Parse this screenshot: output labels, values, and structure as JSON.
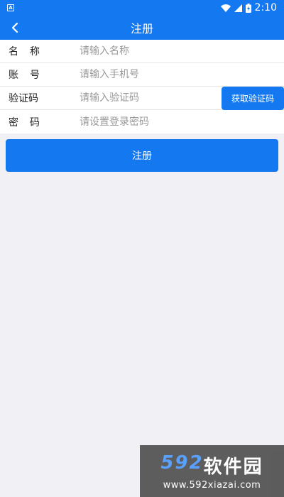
{
  "statusbar": {
    "time": "2:10",
    "notification_icon": "A"
  },
  "header": {
    "title": "注册"
  },
  "form": {
    "name": {
      "label": "名称",
      "placeholder": "请输入名称"
    },
    "account": {
      "label": "账号",
      "placeholder": "请输入手机号"
    },
    "code": {
      "label": "验证码",
      "placeholder": "请输入验证码",
      "button_label": "获取验证码"
    },
    "password": {
      "label": "密码",
      "placeholder": "请设置登录密码"
    }
  },
  "submit": {
    "label": "注册"
  },
  "watermark": {
    "number": "592",
    "text": "软件园",
    "url": "www.592xiazai.com"
  },
  "colors": {
    "primary": "#1478f0",
    "background": "#f0f0f5"
  }
}
